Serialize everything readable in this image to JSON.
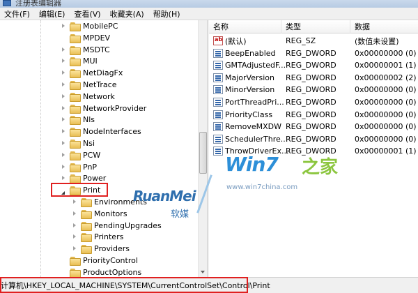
{
  "window": {
    "title": "注册表编辑器"
  },
  "menu": [
    "文件(F)",
    "编辑(E)",
    "查看(V)",
    "收藏夹(A)",
    "帮助(H)"
  ],
  "tree": [
    {
      "label": "MobilePC",
      "level": 1,
      "state": "collapsed"
    },
    {
      "label": "MPDEV",
      "level": 1,
      "state": "none"
    },
    {
      "label": "MSDTC",
      "level": 1,
      "state": "collapsed"
    },
    {
      "label": "MUI",
      "level": 1,
      "state": "collapsed"
    },
    {
      "label": "NetDiagFx",
      "level": 1,
      "state": "collapsed"
    },
    {
      "label": "NetTrace",
      "level": 1,
      "state": "collapsed"
    },
    {
      "label": "Network",
      "level": 1,
      "state": "collapsed"
    },
    {
      "label": "NetworkProvider",
      "level": 1,
      "state": "collapsed"
    },
    {
      "label": "Nls",
      "level": 1,
      "state": "collapsed"
    },
    {
      "label": "NodeInterfaces",
      "level": 1,
      "state": "collapsed"
    },
    {
      "label": "Nsi",
      "level": 1,
      "state": "collapsed"
    },
    {
      "label": "PCW",
      "level": 1,
      "state": "collapsed"
    },
    {
      "label": "PnP",
      "level": 1,
      "state": "collapsed"
    },
    {
      "label": "Power",
      "level": 1,
      "state": "collapsed"
    },
    {
      "label": "Print",
      "level": 1,
      "state": "expanded"
    },
    {
      "label": "Environments",
      "level": 2,
      "state": "collapsed"
    },
    {
      "label": "Monitors",
      "level": 2,
      "state": "collapsed"
    },
    {
      "label": "PendingUpgrades",
      "level": 2,
      "state": "collapsed"
    },
    {
      "label": "Printers",
      "level": 2,
      "state": "collapsed"
    },
    {
      "label": "Providers",
      "level": 2,
      "state": "collapsed"
    },
    {
      "label": "PriorityControl",
      "level": 1,
      "state": "none"
    },
    {
      "label": "ProductOptions",
      "level": 1,
      "state": "none"
    }
  ],
  "columns": {
    "name": "名称",
    "type": "类型",
    "data": "数据"
  },
  "values": [
    {
      "name": "(默认)",
      "type": "REG_SZ",
      "data": "(数值未设置)",
      "icon": "string-value-icon"
    },
    {
      "name": "BeepEnabled",
      "type": "REG_DWORD",
      "data": "0x00000000 (0)",
      "icon": "dword-value-icon"
    },
    {
      "name": "GMTAdjustedF...",
      "type": "REG_DWORD",
      "data": "0x00000001 (1)",
      "icon": "dword-value-icon"
    },
    {
      "name": "MajorVersion",
      "type": "REG_DWORD",
      "data": "0x00000002 (2)",
      "icon": "dword-value-icon"
    },
    {
      "name": "MinorVersion",
      "type": "REG_DWORD",
      "data": "0x00000000 (0)",
      "icon": "dword-value-icon"
    },
    {
      "name": "PortThreadPri...",
      "type": "REG_DWORD",
      "data": "0x00000000 (0)",
      "icon": "dword-value-icon"
    },
    {
      "name": "PriorityClass",
      "type": "REG_DWORD",
      "data": "0x00000000 (0)",
      "icon": "dword-value-icon"
    },
    {
      "name": "RemoveMXDW",
      "type": "REG_DWORD",
      "data": "0x00000000 (0)",
      "icon": "dword-value-icon"
    },
    {
      "name": "SchedulerThre...",
      "type": "REG_DWORD",
      "data": "0x00000000 (0)",
      "icon": "dword-value-icon"
    },
    {
      "name": "ThrowDriverEx...",
      "type": "REG_DWORD",
      "data": "0x00000001 (1)",
      "icon": "dword-value-icon"
    }
  ],
  "status": {
    "path": "计算机\\HKEY_LOCAL_MACHINE\\SYSTEM\\CurrentControlSet\\Control\\Print"
  },
  "watermark": {
    "runmei": "RuanMei",
    "runmei_cn": "软媒",
    "win7": "Win7",
    "win7_cn": "之家",
    "url": "www.win7china.com"
  },
  "colors": {
    "highlight": "#e02020",
    "win7_blue": "#2d8fd8",
    "win7_green": "#8cc63f"
  }
}
